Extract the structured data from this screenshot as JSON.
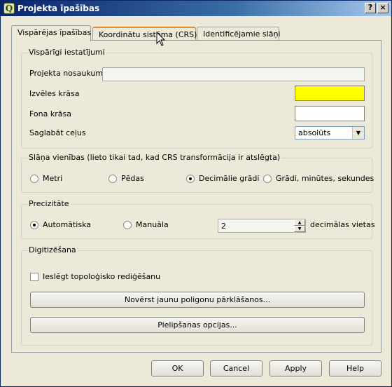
{
  "window": {
    "title": "Projekta īpašības",
    "help_button": "?",
    "close_button": "×"
  },
  "tabs": [
    {
      "label": "Vispārējas īpašības",
      "active": true
    },
    {
      "label": "Koordinātu sistēma (CRS)",
      "active": false
    },
    {
      "label": "Identificējamie slāņi",
      "active": false
    }
  ],
  "general": {
    "title": "Vispārīgi iestatījumi",
    "project_name_label": "Projekta nosaukums",
    "project_name_value": "",
    "selection_color_label": "Izvēles krāsa",
    "selection_color": "#ffff00",
    "background_color_label": "Fona krāsa",
    "background_color": "#ffffff",
    "save_paths_label": "Saglabāt ceļus",
    "save_paths_value": "absolūts"
  },
  "units": {
    "title": "Slāņa vienības (lieto tikai tad, kad CRS transformācija ir atslēgta)",
    "options": [
      {
        "label": "Metri",
        "checked": false
      },
      {
        "label": "Pēdas",
        "checked": false
      },
      {
        "label": "Decimālie grādi",
        "checked": true
      },
      {
        "label": "Grādi, minūtes, sekundes",
        "checked": false
      }
    ]
  },
  "precision": {
    "title": "Precizitāte",
    "automatic_label": "Automātiska",
    "automatic_checked": true,
    "manual_label": "Manuāla",
    "manual_checked": false,
    "decimal_value": "2",
    "decimal_suffix": "decimālas vietas"
  },
  "digitizing": {
    "title": "Digitizēšana",
    "topology_label": "Ieslēgt topoloģisko rediģēšanu",
    "topology_checked": false,
    "avoid_overlap_button": "Novērst jaunu poligonu pārklāšanos...",
    "snapping_button": "Pielipšanas opcijas..."
  },
  "footer": {
    "ok": "OK",
    "cancel": "Cancel",
    "apply": "Apply",
    "help": "Help"
  }
}
